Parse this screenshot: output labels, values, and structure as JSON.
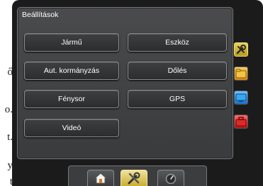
{
  "page_fragments": [
    "ő",
    "o.",
    "t.",
    "y",
    "t"
  ],
  "settings": {
    "title": "Beállítások",
    "buttons": {
      "vehicle": "Jármű",
      "implement": "Eszköz",
      "auto_steering": "Aut. kormányzás",
      "tilt": "Dőlés",
      "lightbar": "Fénysor",
      "gps": "GPS",
      "video": "Videó"
    }
  },
  "side_tabs": [
    {
      "icon": "wrench-icon",
      "active": true
    },
    {
      "icon": "folder-icon",
      "active": false
    },
    {
      "icon": "screen-icon",
      "active": false
    },
    {
      "icon": "toolbox-icon",
      "active": false
    }
  ],
  "bottom_nav": [
    {
      "icon": "home-icon",
      "active": false
    },
    {
      "icon": "tools-icon",
      "active": true
    },
    {
      "icon": "gauge-icon",
      "active": false
    }
  ],
  "colors": {
    "accent": "#d9c24a",
    "panel": "#434446",
    "frame": "#1b1b1b"
  }
}
